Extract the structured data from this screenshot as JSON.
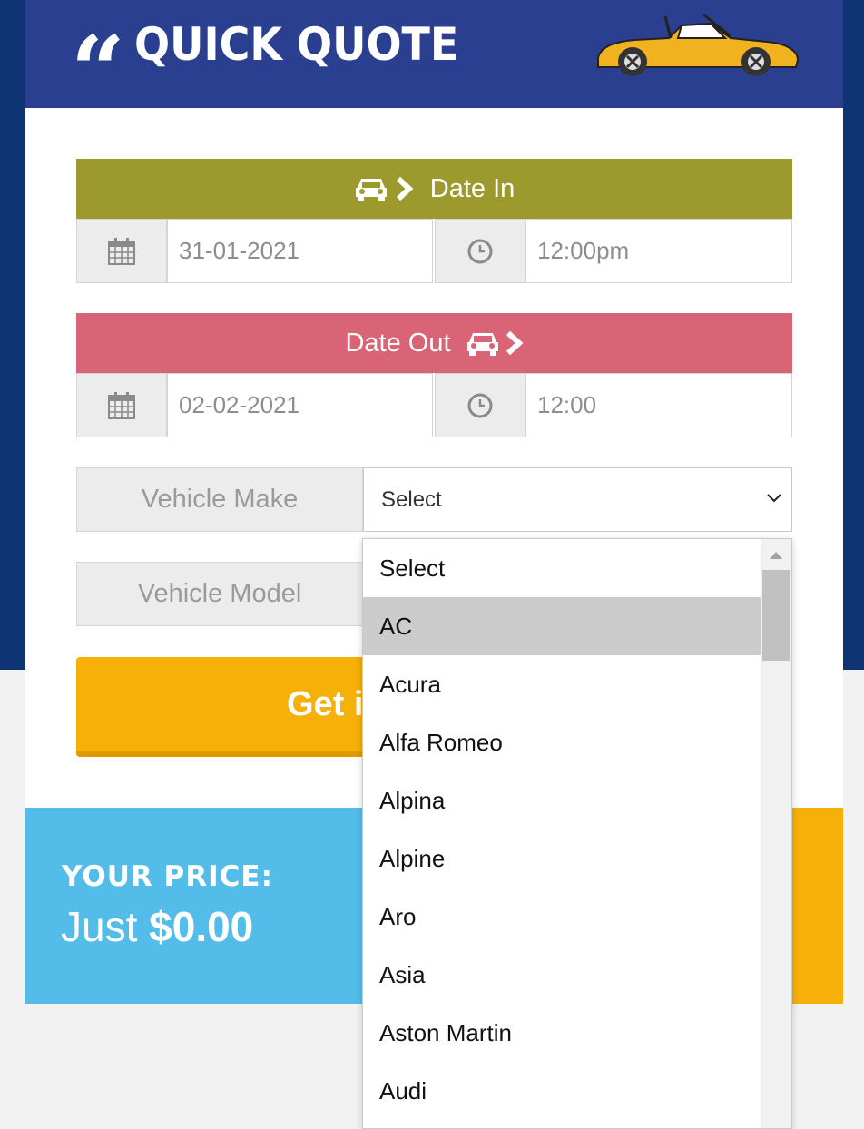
{
  "header": {
    "title": "QUICK QUOTE",
    "quote_glyph": "“",
    "quote_icon": "quote-icon",
    "illustration": "convertible-car-illustration"
  },
  "date_in": {
    "label": "Date In",
    "date_value": "31-01-2021",
    "time_value": "12:00pm",
    "color": "#9c9a2d"
  },
  "date_out": {
    "label": "Date Out",
    "date_value": "02-02-2021",
    "time_value": "12:00",
    "color": "#d86475"
  },
  "vehicle_make": {
    "label": "Vehicle Make",
    "selected": "Select"
  },
  "vehicle_model": {
    "label": "Vehicle Model"
  },
  "button": {
    "label": "Get i"
  },
  "price": {
    "label": "YOUR PRICE:",
    "prefix": "Just",
    "amount": "$0.00"
  },
  "dropdown": {
    "highlighted": "AC",
    "options": [
      "Select",
      "AC",
      "Acura",
      "Alfa Romeo",
      "Alpina",
      "Alpine",
      "Aro",
      "Asia",
      "Aston Martin",
      "Audi"
    ]
  },
  "colors": {
    "header_bg": "#2a3f8f",
    "page_bg": "#0e3474",
    "button": "#f7b007",
    "price_panel": "#54bce9"
  }
}
